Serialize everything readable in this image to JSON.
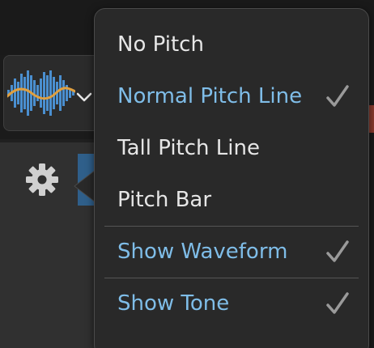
{
  "display_menu": {
    "items": [
      {
        "label": "No Pitch",
        "selected": false
      },
      {
        "label": "Normal Pitch Line",
        "selected": true
      },
      {
        "label": "Tall Pitch Line",
        "selected": false
      },
      {
        "label": "Pitch Bar",
        "selected": false
      },
      {
        "label": "Show Waveform",
        "selected": true
      },
      {
        "label": "Show Tone",
        "selected": true
      }
    ]
  },
  "colors": {
    "selected_text": "#7fbde8",
    "normal_text": "#e6e6e6",
    "checkmark": "#9a9a9a",
    "waveform": "#4a8fd0",
    "pitch_line": "#e0a040"
  },
  "icons": {
    "display_mode": "waveform-pitch-icon",
    "dropdown": "chevron-down-icon",
    "settings": "gear-icon",
    "check": "checkmark-icon"
  }
}
